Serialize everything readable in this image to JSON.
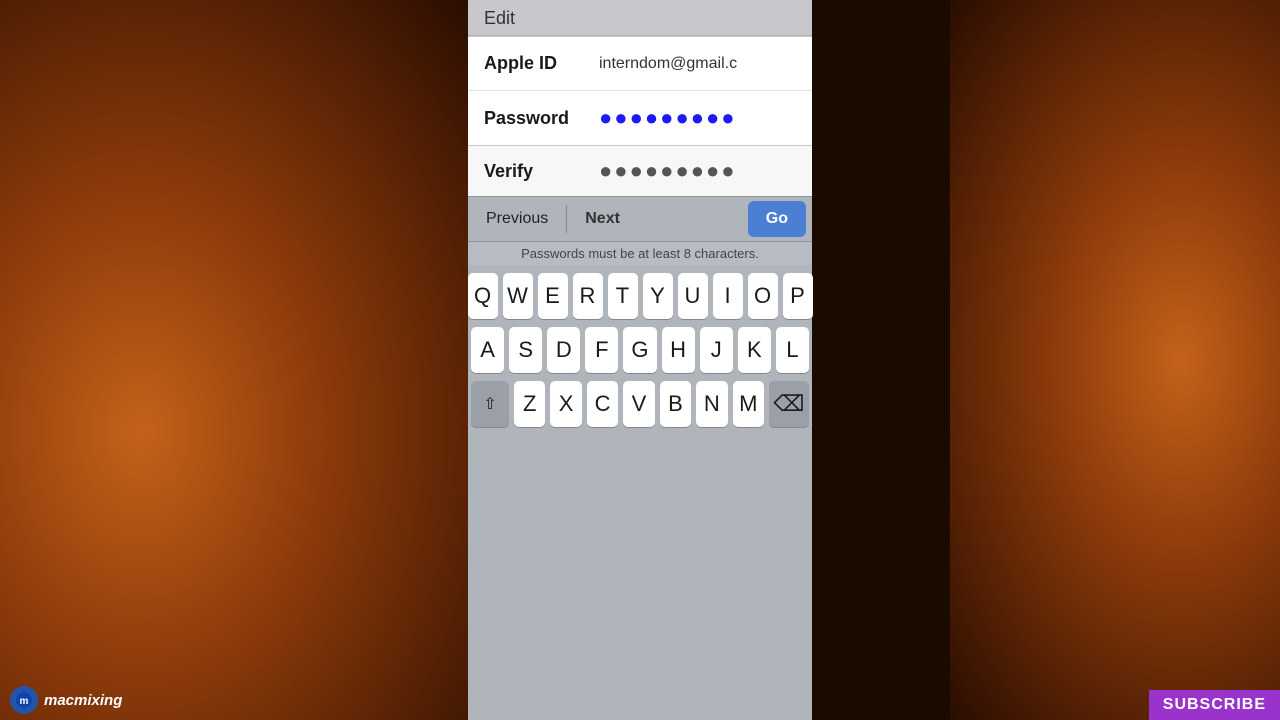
{
  "background": {
    "leftColor": "#c4621a",
    "rightColor": "#c4621a"
  },
  "topBar": {
    "editLabel": "Edit"
  },
  "form": {
    "appleIdLabel": "Apple ID",
    "appleIdValue": "interndom@gmail.c",
    "passwordLabel": "Password",
    "passwordDots": "●●●●●●●●●",
    "verifyLabel": "Verify",
    "verifyDots": "●●●●●●●●●"
  },
  "toolbar": {
    "previousLabel": "Previous",
    "nextLabel": "Next",
    "goLabel": "Go"
  },
  "hint": {
    "text": "Passwords must be at least 8 characters."
  },
  "keyboard": {
    "row1": [
      "Q",
      "W",
      "E",
      "R",
      "T",
      "Y",
      "U",
      "I",
      "O",
      "P"
    ],
    "row2": [
      "A",
      "S",
      "D",
      "F",
      "G",
      "H",
      "J",
      "K",
      "L"
    ],
    "row3": [
      "Z",
      "X",
      "C",
      "V",
      "B",
      "N",
      "M"
    ],
    "shiftSymbol": "⇧",
    "deleteSymbol": "⌫"
  },
  "branding": {
    "logoText": "macmixing",
    "subscribeText": "SUBSCRIBE"
  }
}
